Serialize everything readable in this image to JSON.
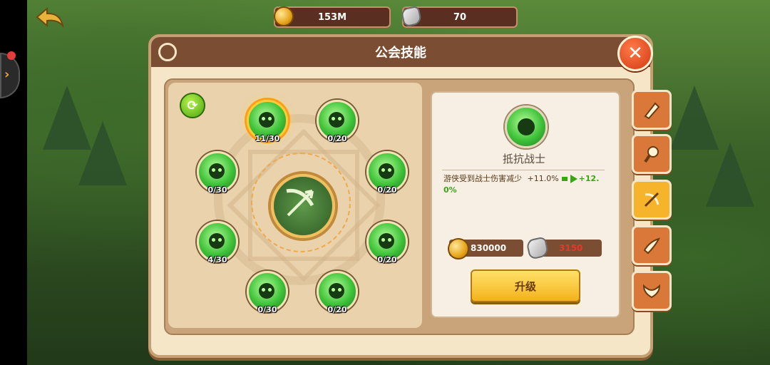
{
  "header": {
    "gold": "153M",
    "stones": "70"
  },
  "dialog": {
    "title": "公会技能"
  },
  "skills": [
    {
      "level": "11/30",
      "active": true
    },
    {
      "level": "0/20",
      "active": false
    },
    {
      "level": "0/30",
      "active": false
    },
    {
      "level": "0/20",
      "active": false
    },
    {
      "level": "4/30",
      "active": false
    },
    {
      "level": "0/20",
      "active": false
    },
    {
      "level": "0/30",
      "active": false
    },
    {
      "level": "0/20",
      "active": false
    }
  ],
  "detail": {
    "name": "抵抗战士",
    "description": "游侠受到战士伤害减少",
    "current_value": "+11.0%",
    "next_value_line1": "+12.",
    "next_value_line2": "0%",
    "gold_cost": "830000",
    "stone_cost": "3150",
    "upgrade_label": "升级"
  },
  "colors": {
    "gold_cost_text": "#ffffff",
    "stone_cost_text": "#e23a2a",
    "increase_green": "#3aa514"
  },
  "side_tabs": [
    "skill-icon-1",
    "skill-icon-2",
    "bow-arrow-icon",
    "skill-icon-4",
    "wings-icon"
  ]
}
